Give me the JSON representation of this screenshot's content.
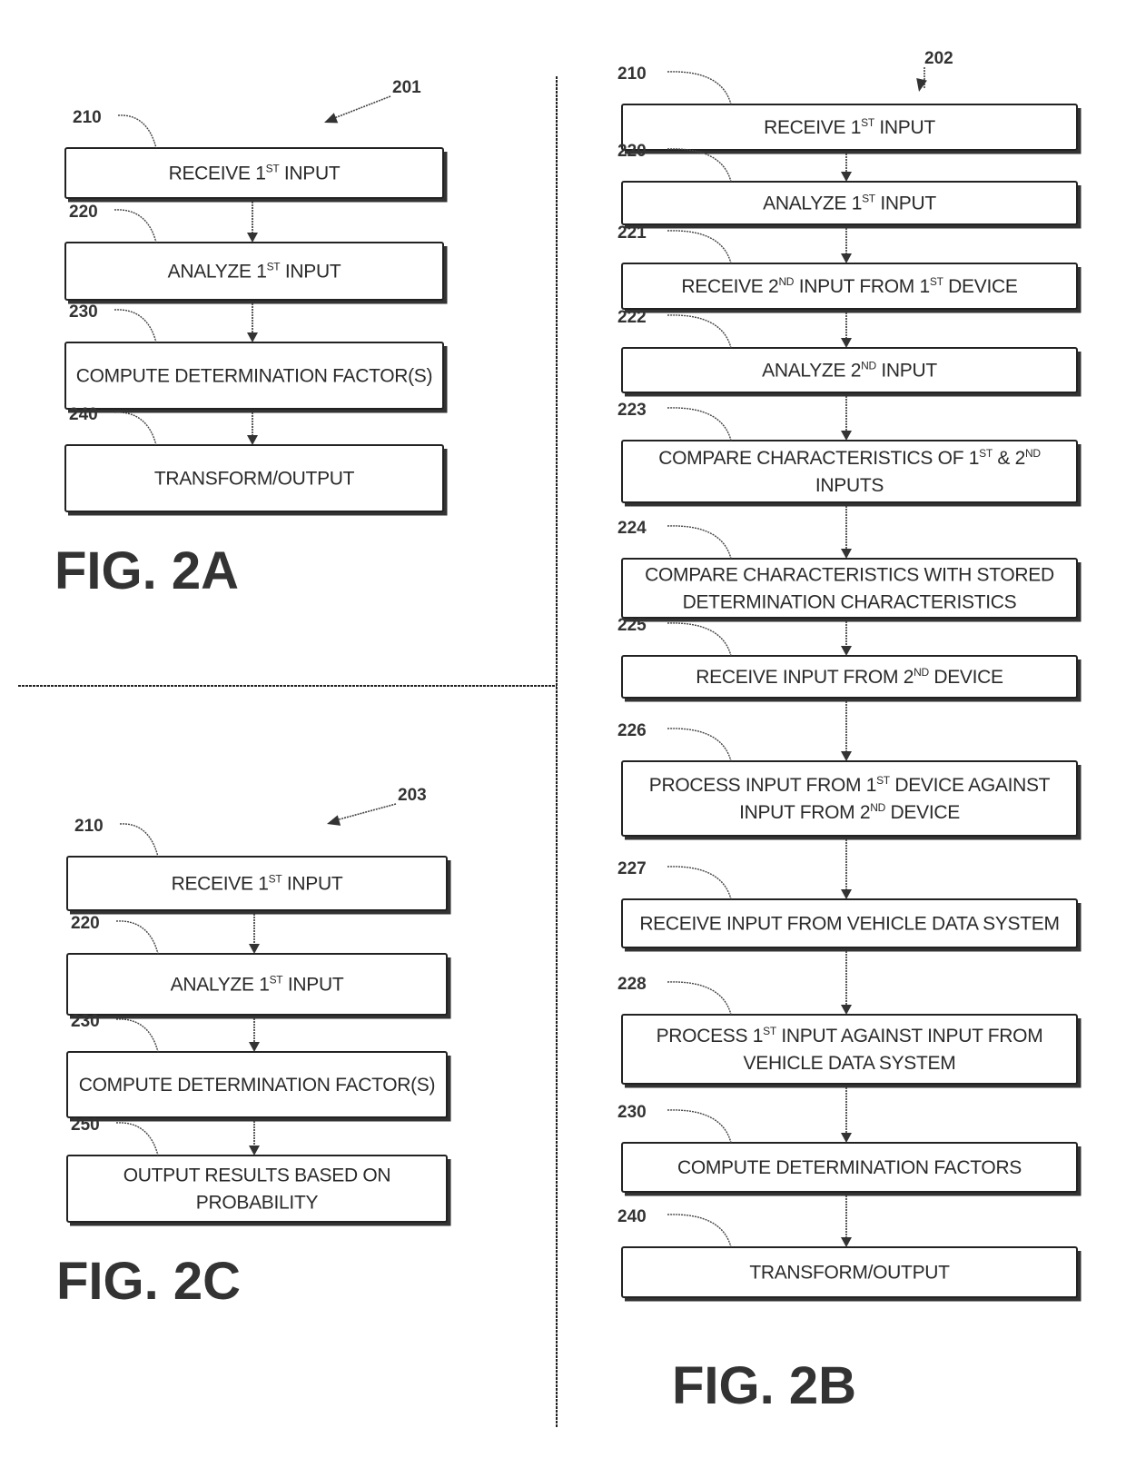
{
  "figures": [
    {
      "id": "fig2a",
      "label": "FIG. 2A",
      "ref": "201",
      "steps": [
        {
          "ref": "210",
          "lines": [
            [
              "RECEIVE 1",
              "ST",
              " INPUT"
            ]
          ]
        },
        {
          "ref": "220",
          "lines": [
            [
              "ANALYZE 1",
              "ST",
              " INPUT"
            ]
          ]
        },
        {
          "ref": "230",
          "lines": [
            [
              "COMPUTE DETERMINATION FACTOR(S)",
              "",
              ""
            ]
          ]
        },
        {
          "ref": "240",
          "lines": [
            [
              "TRANSFORM/OUTPUT",
              "",
              ""
            ]
          ]
        }
      ]
    },
    {
      "id": "fig2b",
      "label": "FIG. 2B",
      "ref": "202",
      "steps": [
        {
          "ref": "210",
          "lines": [
            [
              "RECEIVE 1",
              "ST",
              " INPUT"
            ]
          ]
        },
        {
          "ref": "220",
          "lines": [
            [
              "ANALYZE 1",
              "ST",
              " INPUT"
            ]
          ]
        },
        {
          "ref": "221",
          "lines": [
            [
              "RECEIVE 2",
              "ND",
              " INPUT FROM 1",
              "ST",
              " DEVICE"
            ]
          ]
        },
        {
          "ref": "222",
          "lines": [
            [
              "ANALYZE 2",
              "ND",
              " INPUT"
            ]
          ]
        },
        {
          "ref": "223",
          "lines": [
            [
              "COMPARE CHARACTERISTICS OF 1",
              "ST",
              " & 2",
              "ND",
              ""
            ],
            [
              "INPUTS"
            ]
          ]
        },
        {
          "ref": "224",
          "lines": [
            [
              "COMPARE CHARACTERISTICS WITH STORED"
            ],
            [
              "DETERMINATION CHARACTERISTICS"
            ]
          ]
        },
        {
          "ref": "225",
          "lines": [
            [
              "RECEIVE INPUT FROM 2",
              "ND",
              " DEVICE"
            ]
          ]
        },
        {
          "ref": "226",
          "lines": [
            [
              "PROCESS INPUT FROM 1",
              "ST",
              " DEVICE AGAINST"
            ],
            [
              "INPUT FROM 2",
              "ND",
              " DEVICE"
            ]
          ]
        },
        {
          "ref": "227",
          "lines": [
            [
              "RECEIVE INPUT FROM VEHICLE DATA SYSTEM"
            ]
          ]
        },
        {
          "ref": "228",
          "lines": [
            [
              "PROCESS 1",
              "ST",
              " INPUT AGAINST INPUT FROM"
            ],
            [
              "VEHICLE DATA SYSTEM"
            ]
          ]
        },
        {
          "ref": "230",
          "lines": [
            [
              "COMPUTE DETERMINATION FACTORS"
            ]
          ]
        },
        {
          "ref": "240",
          "lines": [
            [
              "TRANSFORM/OUTPUT"
            ]
          ]
        }
      ]
    },
    {
      "id": "fig2c",
      "label": "FIG. 2C",
      "ref": "203",
      "steps": [
        {
          "ref": "210",
          "lines": [
            [
              "RECEIVE 1",
              "ST",
              " INPUT"
            ]
          ]
        },
        {
          "ref": "220",
          "lines": [
            [
              "ANALYZE 1",
              "ST",
              " INPUT"
            ]
          ]
        },
        {
          "ref": "230",
          "lines": [
            [
              "COMPUTE DETERMINATION FACTOR(S)"
            ]
          ]
        },
        {
          "ref": "250",
          "lines": [
            [
              "OUTPUT RESULTS BASED ON"
            ],
            [
              "PROBABILITY"
            ]
          ]
        }
      ]
    }
  ]
}
